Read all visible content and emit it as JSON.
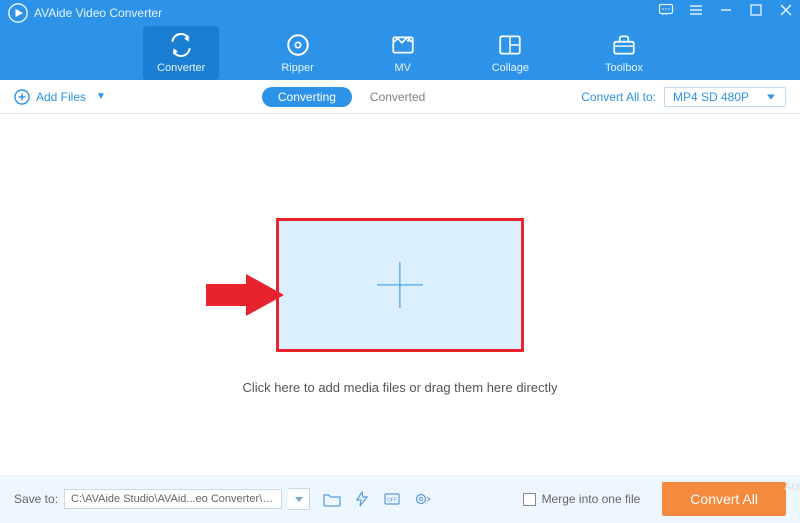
{
  "app": {
    "title": "AVAide Video Converter"
  },
  "main_tabs": {
    "converter": "Converter",
    "ripper": "Ripper",
    "mv": "MV",
    "collage": "Collage",
    "toolbox": "Toolbox"
  },
  "toolbar": {
    "add_files": "Add Files",
    "subtabs": {
      "converting": "Converting",
      "converted": "Converted"
    },
    "convert_all_label": "Convert All to:",
    "convert_all_value": "MP4 SD 480P"
  },
  "content": {
    "hint": "Click here to add media files or drag them here directly"
  },
  "footer": {
    "save_to_label": "Save to:",
    "save_path": "C:\\AVAide Studio\\AVAid...eo Converter\\Converted",
    "merge_label": "Merge into one file",
    "convert_all_button": "Convert All"
  },
  "watermark": "Act"
}
